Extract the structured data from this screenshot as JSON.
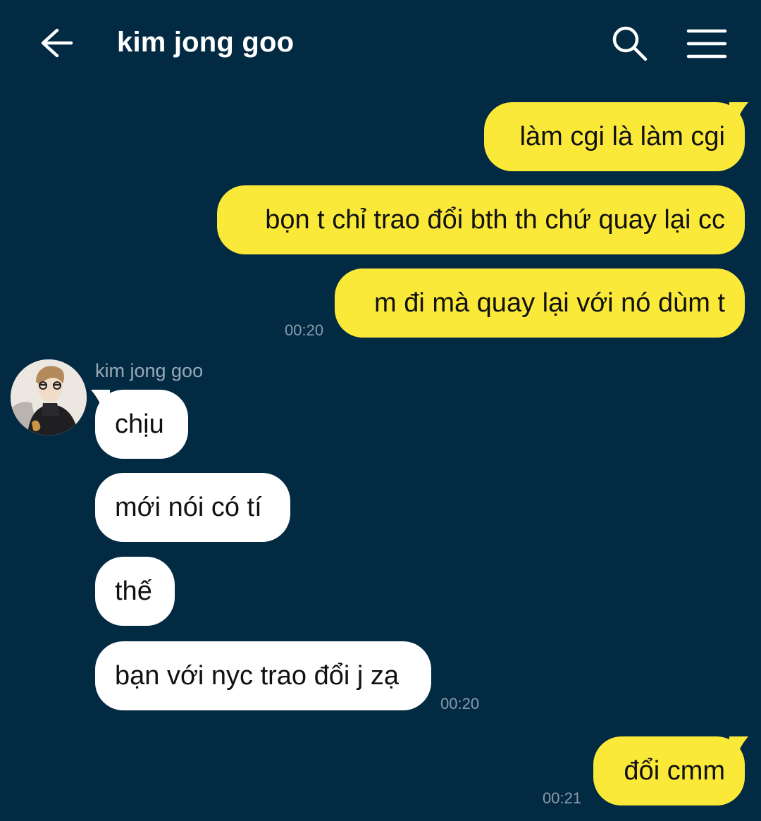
{
  "header": {
    "title": "kim jong goo",
    "back_icon": "arrow-left-icon",
    "search_icon": "search-icon",
    "menu_icon": "hamburger-menu-icon"
  },
  "colors": {
    "background": "#022a42",
    "outgoing_bubble": "#fbe93a",
    "incoming_bubble": "#ffffff"
  },
  "messages": {
    "out_group_1": [
      "làm cgi là làm cgi",
      "bọn t chỉ trao đổi bth th chứ quay lại cc",
      "m đi mà quay lại với nó dùm t"
    ],
    "out_group_1_time": "00:20",
    "in_sender": "kim jong goo",
    "in_group": [
      "chịu",
      "mới nói có tí",
      "thế",
      "bạn với nyc trao đổi j zạ"
    ],
    "in_group_time": "00:20",
    "out_group_2": [
      "đổi cmm"
    ],
    "out_group_2_time": "00:21"
  }
}
